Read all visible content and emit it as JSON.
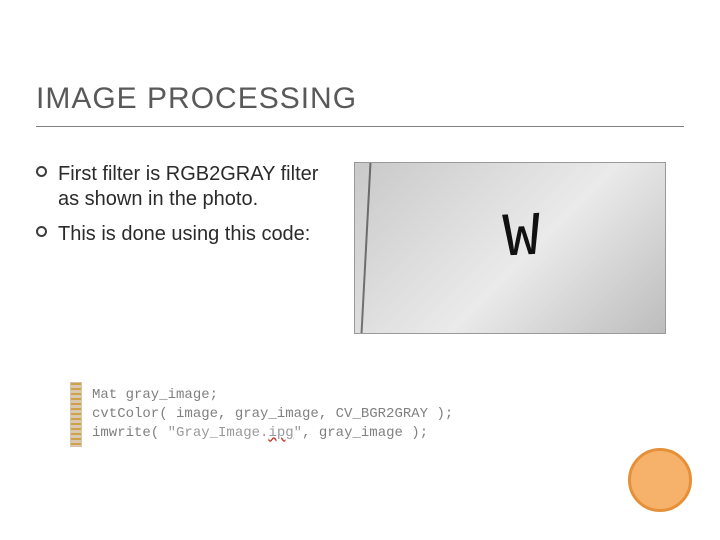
{
  "title": "IMAGE PROCESSING",
  "bullets": [
    "First filter is RGB2GRAY filter as shown in the photo.",
    "This is done using this code:"
  ],
  "photo": {
    "letter": "W"
  },
  "code": {
    "line1_a": "Mat gray_image;",
    "line2_a": "cvtColor( image, gray_image, CV_BGR2GRAY );",
    "line3_a": "imwrite( ",
    "line3_str_a": "\"Gray_Image.",
    "line3_str_b": "ipg",
    "line3_str_c": "\"",
    "line3_b": ", gray_image );"
  }
}
